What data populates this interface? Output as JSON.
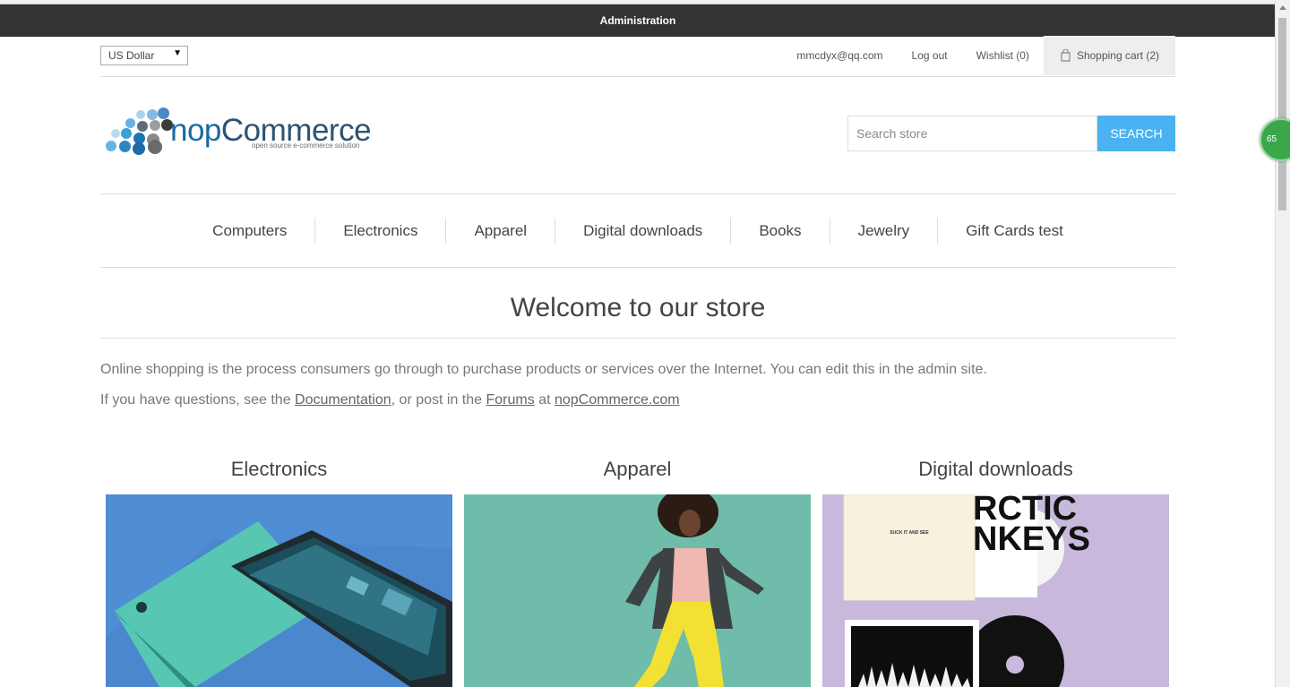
{
  "admin_bar": {
    "label": "Administration"
  },
  "header": {
    "currency": "US Dollar",
    "email": "mmcdyx@qq.com",
    "logout": "Log out",
    "wishlist": "Wishlist (0)",
    "cart": "Shopping cart (2)"
  },
  "logo": {
    "name_nop": "nop",
    "name_commerce": "Commerce",
    "tagline": "open source e-commerce solution"
  },
  "search": {
    "placeholder": "Search store",
    "button": "SEARCH"
  },
  "menu": [
    "Computers",
    "Electronics",
    "Apparel",
    "Digital downloads",
    "Books",
    "Jewelry",
    "Gift Cards test"
  ],
  "welcome": {
    "title": "Welcome to our store"
  },
  "intro": {
    "line1": "Online shopping is the process consumers go through to purchase products or services over the Internet. You can edit this in the admin site.",
    "line2_prefix": "If you have questions, see the ",
    "doc_link": "Documentation",
    "line2_mid": ", or post in the ",
    "forums_link": "Forums",
    "line2_at": " at ",
    "site_link": "nopCommerce.com"
  },
  "categories": [
    {
      "title": "Electronics",
      "image": "phone-image"
    },
    {
      "title": "Apparel",
      "image": "jumping-woman-image"
    },
    {
      "title": "Digital downloads",
      "image": "album-covers-image"
    }
  ],
  "album_text": {
    "cover1": "SUCK IT AND SEE",
    "cover2": "RCTIC NKEYS"
  },
  "side_badge": "65",
  "colors": {
    "admin_bar": "#333333",
    "search_button": "#4ab2f1",
    "electronics_bg": "#4f8ed4",
    "apparel_bg": "#6fbcaa",
    "downloads_bg": "#c8b8dc"
  }
}
